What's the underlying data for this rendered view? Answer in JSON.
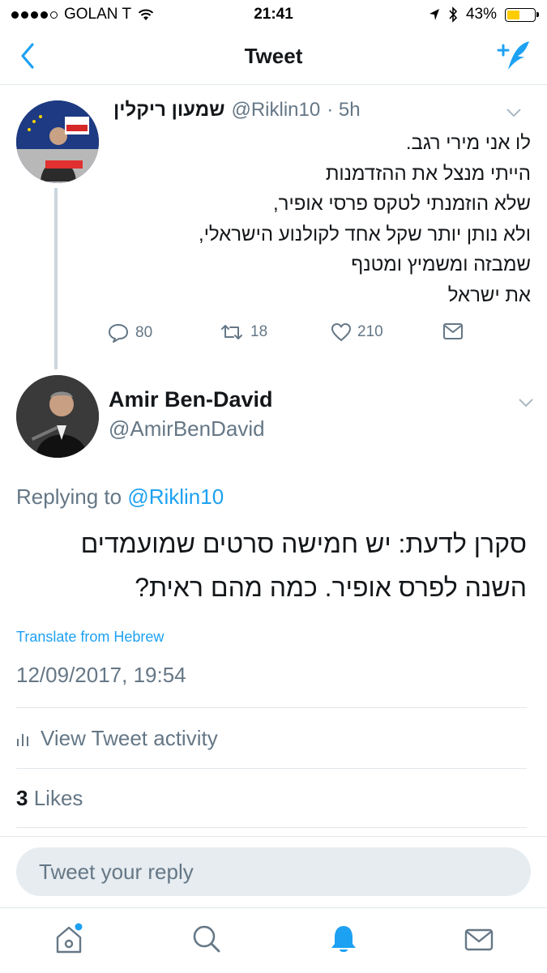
{
  "status_bar": {
    "carrier": "GOLAN T",
    "time": "21:41",
    "battery": "43%"
  },
  "nav": {
    "title": "Tweet"
  },
  "tweet1": {
    "name": "שמעון ריקלין",
    "handle": "@Riklin10",
    "time": "· 5h",
    "lines": [
      "לו אני מירי רגב.",
      "הייתי מנצל את ההזדמנות",
      "שלא הוזמנתי לטקס פרסי אופיר,",
      "ולא נותן יותר שקל אחד לקולנוע הישראלי,",
      "שמבזה ומשמיץ ומטנף",
      "את ישראל"
    ],
    "replies": "80",
    "retweets": "18",
    "likes": "210"
  },
  "tweet2": {
    "name": "Amir Ben-David",
    "handle": "@AmirBenDavid",
    "replying_prefix": "Replying to",
    "replying_to": "@Riklin10",
    "lines": [
      "סקרן לדעת: יש חמישה סרטים שמועמדים",
      "השנה לפרס אופיר. כמה מהם ראית?"
    ],
    "translate": "Translate from Hebrew",
    "datetime": "12/09/2017, 19:54",
    "activity": "View Tweet activity",
    "likes_count": "3",
    "likes_label": "Likes"
  },
  "reply": {
    "placeholder": "Tweet your reply"
  },
  "colors": {
    "accent": "#1da1f2",
    "secondary_text": "#657786",
    "divider": "#e1e8ed"
  }
}
